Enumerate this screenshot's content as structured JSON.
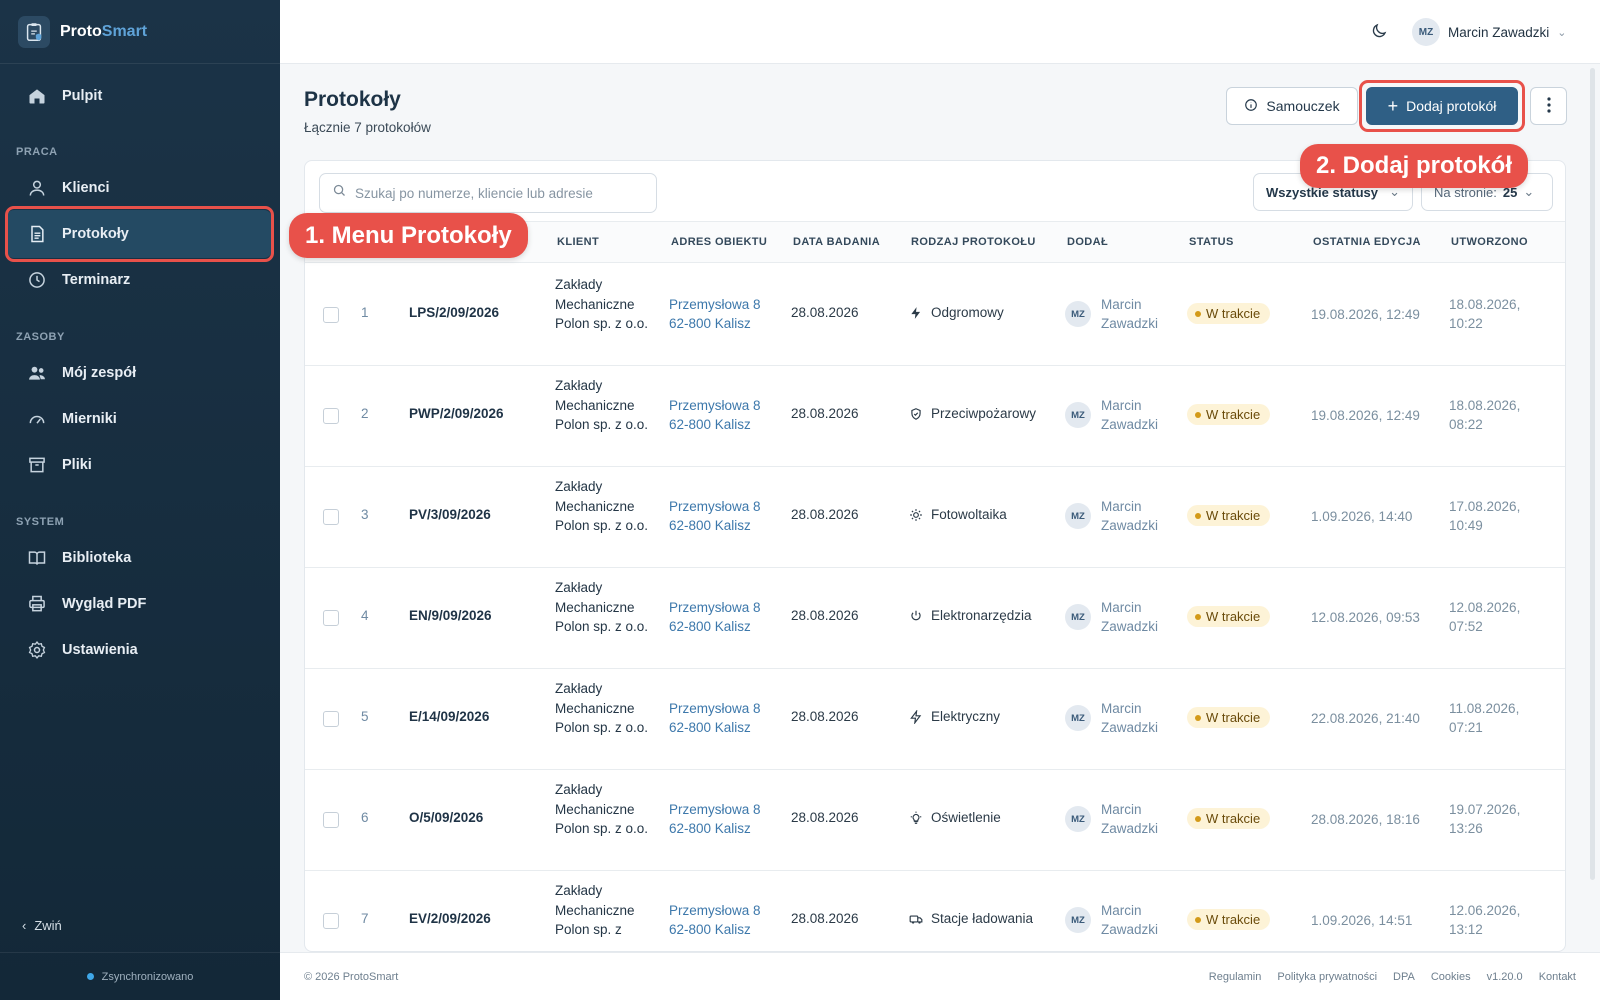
{
  "brand": {
    "name_part1": "Proto",
    "name_part2": "Smart"
  },
  "sidebar": {
    "items": [
      {
        "label": "Pulpit",
        "icon": "home-icon"
      },
      {
        "section": "PRACA"
      },
      {
        "label": "Klienci",
        "icon": "user-icon"
      },
      {
        "label": "Protokoły",
        "icon": "document-icon",
        "active": true
      },
      {
        "label": "Terminarz",
        "icon": "clock-icon"
      },
      {
        "section": "ZASOBY"
      },
      {
        "label": "Mój zespół",
        "icon": "team-icon"
      },
      {
        "label": "Mierniki",
        "icon": "gauge-icon"
      },
      {
        "label": "Pliki",
        "icon": "archive-icon"
      },
      {
        "section": "SYSTEM"
      },
      {
        "label": "Biblioteka",
        "icon": "book-icon"
      },
      {
        "label": "Wygląd PDF",
        "icon": "printer-icon"
      },
      {
        "label": "Ustawienia",
        "icon": "gear-icon"
      }
    ],
    "collapse_label": "Zwiń",
    "sync_label": "Zsynchronizowano"
  },
  "header": {
    "user_initials": "MZ",
    "user_name": "Marcin Zawadzki"
  },
  "page": {
    "title": "Protokoły",
    "subtitle": "Łącznie 7 protokołów",
    "tutorial_label": "Samouczek",
    "add_label": "Dodaj protokół"
  },
  "callouts": {
    "menu": "1. Menu Protokoły",
    "add": "2. Dodaj protokół"
  },
  "filters": {
    "search_placeholder": "Szukaj po numerze, kliencie lub adresie",
    "status_label": "Wszystkie statusy",
    "per_page_label": "Na stronie:",
    "per_page_value": "25"
  },
  "table": {
    "columns": [
      "KLIENT",
      "ADRES OBIEKTU",
      "DATA BADANIA",
      "RODZAJ PROTOKOŁU",
      "DODAŁ",
      "STATUS",
      "OSTATNIA EDYCJA",
      "UTWORZONO"
    ],
    "rows": [
      {
        "no": "1",
        "number": "LPS/2/09/2026",
        "client": "Zakłady Mechaniczne Polon sp. z o.o.",
        "addr1": "Przemysłowa 8",
        "addr2": "62-800 Kalisz",
        "date": "28.08.2026",
        "type": "Odgromowy",
        "type_icon": "lightning-icon",
        "by_initials": "MZ",
        "by1": "Marcin",
        "by2": "Zawadzki",
        "status": "W trakcie",
        "edited": "19.08.2026, 12:49",
        "created1": "18.08.2026,",
        "created2": "10:22"
      },
      {
        "no": "2",
        "number": "PWP/2/09/2026",
        "client": "Zakłady Mechaniczne Polon sp. z o.o.",
        "addr1": "Przemysłowa 8",
        "addr2": "62-800 Kalisz",
        "date": "28.08.2026",
        "type": "Przeciwpożarowy",
        "type_icon": "shield-icon",
        "by_initials": "MZ",
        "by1": "Marcin",
        "by2": "Zawadzki",
        "status": "W trakcie",
        "edited": "19.08.2026, 12:49",
        "created1": "18.08.2026,",
        "created2": "08:22"
      },
      {
        "no": "3",
        "number": "PV/3/09/2026",
        "client": "Zakłady Mechaniczne Polon sp. z o.o.",
        "addr1": "Przemysłowa 8",
        "addr2": "62-800 Kalisz",
        "date": "28.08.2026",
        "type": "Fotowoltaika",
        "type_icon": "sun-icon",
        "by_initials": "MZ",
        "by1": "Marcin",
        "by2": "Zawadzki",
        "status": "W trakcie",
        "edited": "1.09.2026, 14:40",
        "created1": "17.08.2026,",
        "created2": "10:49"
      },
      {
        "no": "4",
        "number": "EN/9/09/2026",
        "client": "Zakłady Mechaniczne Polon sp. z o.o.",
        "addr1": "Przemysłowa 8",
        "addr2": "62-800 Kalisz",
        "date": "28.08.2026",
        "type": "Elektronarzędzia",
        "type_icon": "power-icon",
        "by_initials": "MZ",
        "by1": "Marcin",
        "by2": "Zawadzki",
        "status": "W trakcie",
        "edited": "12.08.2026, 09:53",
        "created1": "12.08.2026,",
        "created2": "07:52"
      },
      {
        "no": "5",
        "number": "E/14/09/2026",
        "client": "Zakłady Mechaniczne Polon sp. z o.o.",
        "addr1": "Przemysłowa 8",
        "addr2": "62-800 Kalisz",
        "date": "28.08.2026",
        "type": "Elektryczny",
        "type_icon": "lightning-outline-icon",
        "by_initials": "MZ",
        "by1": "Marcin",
        "by2": "Zawadzki",
        "status": "W trakcie",
        "edited": "22.08.2026, 21:40",
        "created1": "11.08.2026,",
        "created2": "07:21"
      },
      {
        "no": "6",
        "number": "O/5/09/2026",
        "client": "Zakłady Mechaniczne Polon sp. z o.o.",
        "addr1": "Przemysłowa 8",
        "addr2": "62-800 Kalisz",
        "date": "28.08.2026",
        "type": "Oświetlenie",
        "type_icon": "bulb-icon",
        "by_initials": "MZ",
        "by1": "Marcin",
        "by2": "Zawadzki",
        "status": "W trakcie",
        "edited": "28.08.2026, 18:16",
        "created1": "19.07.2026,",
        "created2": "13:26"
      },
      {
        "no": "7",
        "number": "EV/2/09/2026",
        "client": "Zakłady Mechaniczne Polon sp. z",
        "addr1": "Przemysłowa 8",
        "addr2": "62-800 Kalisz",
        "date": "28.08.2026",
        "type": "Stacje ładowania",
        "type_icon": "car-icon",
        "by_initials": "MZ",
        "by1": "Marcin",
        "by2": "Zawadzki",
        "status": "W trakcie",
        "edited": "1.09.2026, 14:51",
        "created1": "12.06.2026,",
        "created2": "13:12"
      }
    ]
  },
  "footer": {
    "copyright": "© 2026 ProtoSmart",
    "links": [
      "Regulamin",
      "Polityka prywatności",
      "DPA",
      "Cookies",
      "v1.20.0",
      "Kontakt"
    ]
  },
  "colors": {
    "sidebar_bg": "#1b3347",
    "accent": "#2f5f85",
    "highlight": "#e8514a",
    "status_bg": "#fdf3d7",
    "link": "#3d78ab"
  }
}
